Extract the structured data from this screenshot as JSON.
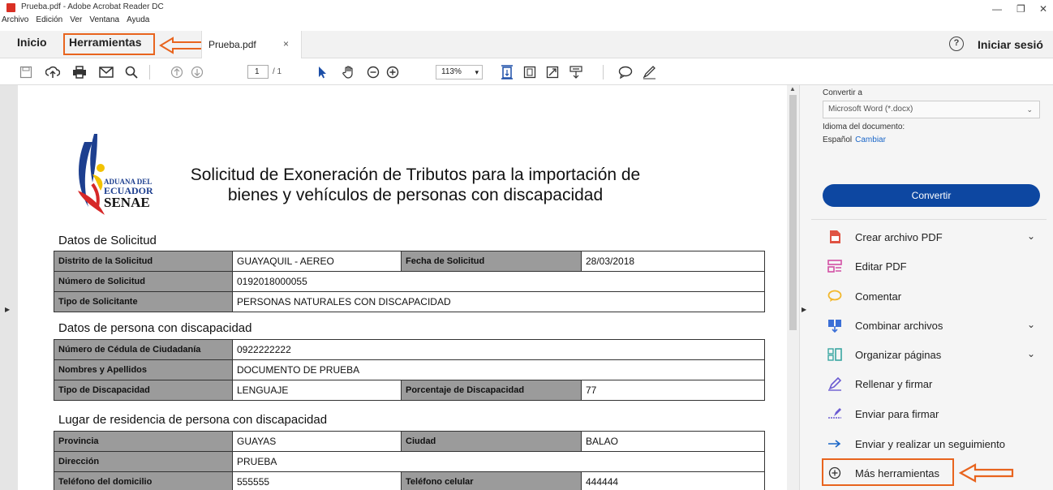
{
  "window": {
    "title": "Prueba.pdf - Adobe Acrobat Reader DC",
    "controls": [
      "—",
      "❐",
      "✕"
    ]
  },
  "menu": [
    "Archivo",
    "Edición",
    "Ver",
    "Ventana",
    "Ayuda"
  ],
  "tabs": {
    "home": "Inicio",
    "tools": "Herramientas",
    "document": "Prueba.pdf",
    "close": "×",
    "help": "?",
    "signin": "Iniciar sesió"
  },
  "toolbar": {
    "page_current": "1",
    "page_total": "/ 1",
    "zoom": "113%"
  },
  "document": {
    "logo": {
      "line1": "ADUANA DEL",
      "line2": "ECUADOR",
      "line3": "SENAE"
    },
    "title_line1": "Solicitud de Exoneración de Tributos para la importación de",
    "title_line2": "bienes y vehículos de personas con discapacidad",
    "sections": {
      "s1": "Datos de Solicitud",
      "s2": "Datos de persona con discapacidad",
      "s3": "Lugar de residencia de persona con discapacidad"
    },
    "t1": {
      "distrito_lbl": "Distrito de la Solicitud",
      "distrito_val": "GUAYAQUIL - AEREO",
      "fecha_lbl": "Fecha de Solicitud",
      "fecha_val": "28/03/2018",
      "numero_lbl": "Número de Solicitud",
      "numero_val": "0192018000055",
      "tipo_lbl": "Tipo de Solicitante",
      "tipo_val": "PERSONAS NATURALES CON DISCAPACIDAD"
    },
    "t2": {
      "cedula_lbl": "Número de Cédula de Ciudadanía",
      "cedula_val": "0922222222",
      "nombres_lbl": "Nombres y Apellidos",
      "nombres_val": "DOCUMENTO DE PRUEBA",
      "disc_lbl": "Tipo de Discapacidad",
      "disc_val": "LENGUAJE",
      "porc_lbl": "Porcentaje de Discapacidad",
      "porc_val": "77"
    },
    "t3": {
      "prov_lbl": "Provincia",
      "prov_val": "GUAYAS",
      "ciudad_lbl": "Ciudad",
      "ciudad_val": "BALAO",
      "dir_lbl": "Dirección",
      "dir_val": "PRUEBA",
      "tel_lbl": "Teléfono del domicilio",
      "tel_val": "555555",
      "cel_lbl": "Teléfono celular",
      "cel_val": "444444"
    }
  },
  "panel": {
    "convert_to_label": "Convertir a",
    "convert_format": "Microsoft Word (*.docx)",
    "language_label": "Idioma del documento:",
    "language_value": "Español",
    "change_link": "Cambiar",
    "convert_button": "Convertir",
    "tools": [
      {
        "label": "Crear archivo PDF",
        "icon": "create-pdf-icon",
        "expandable": true
      },
      {
        "label": "Editar PDF",
        "icon": "edit-pdf-icon",
        "expandable": false
      },
      {
        "label": "Comentar",
        "icon": "comment-icon",
        "expandable": false
      },
      {
        "label": "Combinar archivos",
        "icon": "combine-files-icon",
        "expandable": true
      },
      {
        "label": "Organizar páginas",
        "icon": "organize-pages-icon",
        "expandable": true
      },
      {
        "label": "Rellenar y firmar",
        "icon": "fill-sign-icon",
        "expandable": false
      },
      {
        "label": "Enviar para firmar",
        "icon": "send-sign-icon",
        "expandable": false
      },
      {
        "label": "Enviar y realizar un seguimiento",
        "icon": "send-track-icon",
        "expandable": false
      },
      {
        "label": "Más herramientas",
        "icon": "more-tools-icon",
        "expandable": false
      }
    ]
  },
  "colors": {
    "highlight": "#e8641e",
    "convert_button": "#0d47a1",
    "label_cell": "#9b9b9b"
  }
}
